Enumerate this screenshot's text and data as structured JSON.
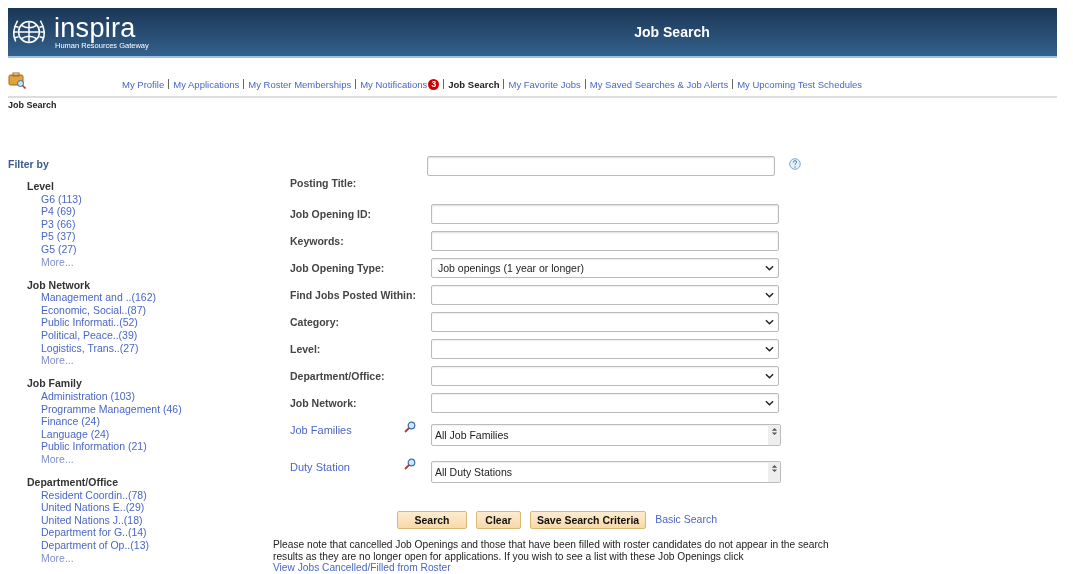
{
  "header": {
    "logo_text": "inspira",
    "logo_subtitle": "Human Resources Gateway",
    "title": "Job Search"
  },
  "nav": [
    {
      "label": "My Profile",
      "selected": false
    },
    {
      "label": "My Applications",
      "selected": false
    },
    {
      "label": "My Roster Memberships",
      "selected": false
    },
    {
      "label": "My Notifications",
      "selected": false,
      "badge": "3"
    },
    {
      "label": "Job Search",
      "selected": true
    },
    {
      "label": "My Favorite Jobs",
      "selected": false
    },
    {
      "label": "My Saved Searches & Job Alerts",
      "selected": false
    },
    {
      "label": "My Upcoming Test Schedules",
      "selected": false
    }
  ],
  "breadcrumb": "Job Search",
  "filter": {
    "title": "Filter by",
    "groups": [
      {
        "title": "Level",
        "items": [
          "G6 (113)",
          "P4 (69)",
          "P3 (66)",
          "P5 (37)",
          "G5 (27)",
          "More..."
        ]
      },
      {
        "title": "Job Network",
        "items": [
          "Management and ..(162)",
          "Economic, Social..(87)",
          "Public Informati..(52)",
          "Political, Peace..(39)",
          "Logistics, Trans..(27)",
          "More..."
        ]
      },
      {
        "title": "Job Family",
        "items": [
          "Administration (103)",
          "Programme Management (46)",
          "Finance (24)",
          "Language (24)",
          "Public Information (21)",
          "More..."
        ]
      },
      {
        "title": "Department/Office",
        "items": [
          "Resident Coordin..(78)",
          "United Nations E..(29)",
          "United Nations J..(18)",
          "Department for G..(14)",
          "Department of Op..(13)",
          "More..."
        ]
      }
    ]
  },
  "form": {
    "fields": [
      {
        "kind": "text",
        "label": "Posting Title:",
        "help": true
      },
      {
        "kind": "text",
        "label": "Job Opening ID:"
      },
      {
        "kind": "text",
        "label": "Keywords:"
      },
      {
        "kind": "select",
        "label": "Job Opening Type:",
        "value": "Job openings (1 year or longer)"
      },
      {
        "kind": "select",
        "label": "Find Jobs Posted Within:"
      },
      {
        "kind": "select",
        "label": "Category:"
      },
      {
        "kind": "select",
        "label": "Level:"
      },
      {
        "kind": "select",
        "label": "Department/Office:"
      },
      {
        "kind": "select",
        "label": "Job Network:"
      },
      {
        "kind": "lookup",
        "label": "Job Families",
        "value": "All Job Families"
      },
      {
        "kind": "lookup",
        "label": "Duty Station",
        "value": "All Duty Stations"
      }
    ],
    "buttons": [
      "Search",
      "Clear",
      "Save Search Criteria"
    ],
    "link": "Basic Search",
    "notice": "Please note that cancelled Job Openings and those that have been filled with roster candidates do not appear in the search results as they are no longer open for applications. If you wish to see a list with these Job Openings click",
    "notice_link": "View Jobs Cancelled/Filled from Roster"
  }
}
